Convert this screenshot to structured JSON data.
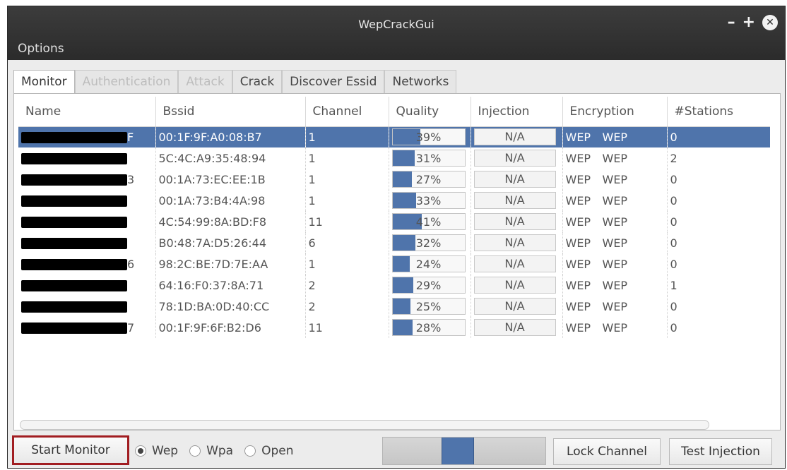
{
  "window": {
    "title": "WepCrackGui",
    "controls": [
      "–",
      "+",
      "✕"
    ]
  },
  "menu": {
    "options_label": "Options"
  },
  "tabs": [
    {
      "label": "Monitor",
      "state": "active"
    },
    {
      "label": "Authentication",
      "state": "disabled"
    },
    {
      "label": "Attack",
      "state": "disabled"
    },
    {
      "label": "Crack",
      "state": "normal"
    },
    {
      "label": "Discover Essid",
      "state": "normal"
    },
    {
      "label": "Networks",
      "state": "normal"
    }
  ],
  "table": {
    "headers": [
      "Name",
      "Bssid",
      "Channel",
      "Quality",
      "Injection",
      "Encryption",
      "#Stations"
    ],
    "rows": [
      {
        "name_suffix": "F",
        "bssid": "00:1F:9F:A0:08:B7",
        "channel": "1",
        "quality": "39%",
        "quality_value": 0.39,
        "injection": "N/A",
        "enc1": "WEP",
        "enc2": "WEP",
        "stations": "0",
        "selected": true
      },
      {
        "name_suffix": "",
        "bssid": "5C:4C:A9:35:48:94",
        "channel": "1",
        "quality": "31%",
        "quality_value": 0.31,
        "injection": "N/A",
        "enc1": "WEP",
        "enc2": "WEP",
        "stations": "2",
        "selected": false
      },
      {
        "name_suffix": "3",
        "bssid": "00:1A:73:EC:EE:1B",
        "channel": "1",
        "quality": "27%",
        "quality_value": 0.27,
        "injection": "N/A",
        "enc1": "WEP",
        "enc2": "WEP",
        "stations": "0",
        "selected": false
      },
      {
        "name_suffix": "",
        "bssid": "00:1A:73:B4:4A:98",
        "channel": "1",
        "quality": "33%",
        "quality_value": 0.33,
        "injection": "N/A",
        "enc1": "WEP",
        "enc2": "WEP",
        "stations": "0",
        "selected": false
      },
      {
        "name_suffix": "",
        "bssid": "4C:54:99:8A:BD:F8",
        "channel": "11",
        "quality": "41%",
        "quality_value": 0.41,
        "injection": "N/A",
        "enc1": "WEP",
        "enc2": "WEP",
        "stations": "0",
        "selected": false
      },
      {
        "name_suffix": "",
        "bssid": "B0:48:7A:D5:26:44",
        "channel": "6",
        "quality": "32%",
        "quality_value": 0.32,
        "injection": "N/A",
        "enc1": "WEP",
        "enc2": "WEP",
        "stations": "0",
        "selected": false
      },
      {
        "name_suffix": "6",
        "bssid": "98:2C:BE:7D:7E:AA",
        "channel": "1",
        "quality": "24%",
        "quality_value": 0.24,
        "injection": "N/A",
        "enc1": "WEP",
        "enc2": "WEP",
        "stations": "0",
        "selected": false
      },
      {
        "name_suffix": "",
        "bssid": "64:16:F0:37:8A:71",
        "channel": "2",
        "quality": "29%",
        "quality_value": 0.29,
        "injection": "N/A",
        "enc1": "WEP",
        "enc2": "WEP",
        "stations": "1",
        "selected": false
      },
      {
        "name_suffix": "",
        "bssid": "78:1D:BA:0D:40:CC",
        "channel": "2",
        "quality": "25%",
        "quality_value": 0.25,
        "injection": "N/A",
        "enc1": "WEP",
        "enc2": "WEP",
        "stations": "0",
        "selected": false
      },
      {
        "name_suffix": "7",
        "bssid": "00:1F:9F:6F:B2:D6",
        "channel": "11",
        "quality": "28%",
        "quality_value": 0.28,
        "injection": "N/A",
        "enc1": "WEP",
        "enc2": "WEP",
        "stations": "0",
        "selected": false
      }
    ]
  },
  "controls": {
    "start_monitor": "Start Monitor",
    "radios": [
      {
        "label": "Wep",
        "checked": true
      },
      {
        "label": "Wpa",
        "checked": false
      },
      {
        "label": "Open",
        "checked": false
      }
    ],
    "channel_slider_level": 0.45,
    "lock_channel": "Lock Channel",
    "test_injection": "Test Injection"
  },
  "colors": {
    "selection": "#4f74ab",
    "highlight_outline": "#a11d21",
    "titlebar": "#2b2b2b"
  }
}
